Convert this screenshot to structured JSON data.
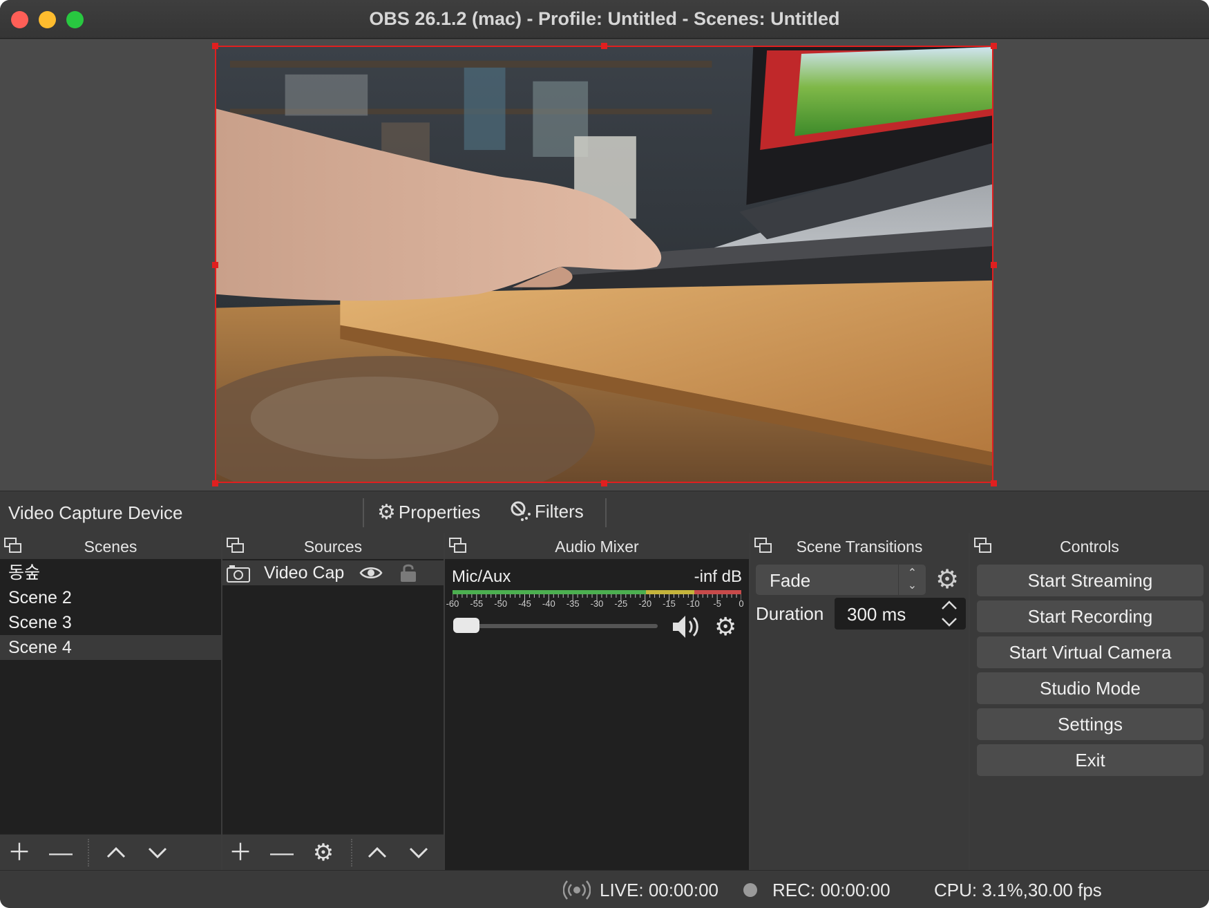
{
  "window": {
    "title": "OBS 26.1.2 (mac) - Profile: Untitled - Scenes: Untitled"
  },
  "source_toolbar": {
    "selected_source": "Video Capture Device",
    "properties_label": "Properties",
    "filters_label": "Filters"
  },
  "scenes": {
    "title": "Scenes",
    "items": [
      "동숲",
      "Scene 2",
      "Scene 3",
      "Scene 4"
    ],
    "selected": "Scene 4"
  },
  "sources": {
    "title": "Sources",
    "items": [
      {
        "label": "Video Cap",
        "icon": "camera-icon",
        "visible": true,
        "locked": false
      }
    ]
  },
  "audio_mixer": {
    "title": "Audio Mixer",
    "channel_name": "Mic/Aux",
    "level_label": "-inf dB",
    "scale_labels": [
      "-60",
      "-55",
      "-50",
      "-45",
      "-40",
      "-35",
      "-30",
      "-25",
      "-20",
      "-15",
      "-10",
      "-5",
      "0"
    ],
    "volume_fraction": 0.0
  },
  "scene_transitions": {
    "title": "Scene Transitions",
    "transition": "Fade",
    "duration_label": "Duration",
    "duration_value": "300 ms"
  },
  "controls": {
    "title": "Controls",
    "buttons": [
      "Start Streaming",
      "Start Recording",
      "Start Virtual Camera",
      "Studio Mode",
      "Settings",
      "Exit"
    ]
  },
  "status": {
    "live": "LIVE: 00:00:00",
    "rec": "REC: 00:00:00",
    "cpu": "CPU: 3.1%,30.00 fps"
  },
  "colors": {
    "selection_border": "#e01f1f",
    "meter_green": "#4caf50",
    "meter_yellow": "#c5b43b",
    "meter_red": "#c84a4a"
  }
}
